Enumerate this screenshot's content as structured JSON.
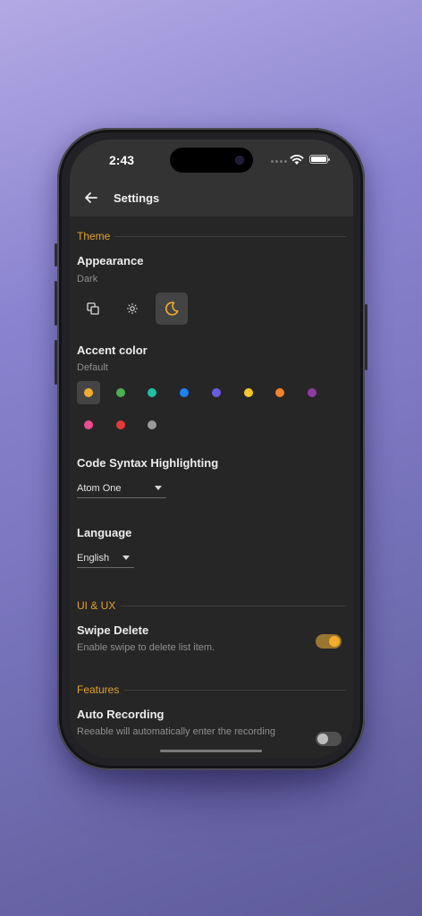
{
  "status": {
    "time": "2:43"
  },
  "appbar": {
    "title": "Settings",
    "back_icon": "arrow-left-icon"
  },
  "theme": {
    "section": "Theme",
    "appearance": {
      "title": "Appearance",
      "value": "Dark",
      "modes": [
        {
          "name": "system",
          "icon": "system-mode-icon",
          "selected": false
        },
        {
          "name": "light",
          "icon": "sun-icon",
          "selected": false
        },
        {
          "name": "dark",
          "icon": "moon-icon",
          "selected": true
        }
      ]
    },
    "accent": {
      "title": "Accent color",
      "value": "Default",
      "colors": [
        "#f2ad2d",
        "#4caf50",
        "#1fbfa9",
        "#1e82f0",
        "#6a5ce0",
        "#f7c62b",
        "#f3832a",
        "#8e3aa0",
        "#ea4e8e",
        "#e33b3b",
        "#9a9a9a"
      ],
      "selected_index": 0
    },
    "syntax": {
      "title": "Code Syntax Highlighting",
      "value": "Atom One"
    },
    "language": {
      "title": "Language",
      "value": "English"
    }
  },
  "uiux": {
    "section": "UI & UX",
    "swipe_delete": {
      "title": "Swipe Delete",
      "description": "Enable swipe to delete list item.",
      "enabled": true
    }
  },
  "features": {
    "section": "Features",
    "auto_recording": {
      "title": "Auto Recording",
      "description": "Reeable will automatically enter the recording"
    }
  },
  "colors": {
    "accent": "#e0a030",
    "background": "#262626",
    "bar": "#333333"
  }
}
